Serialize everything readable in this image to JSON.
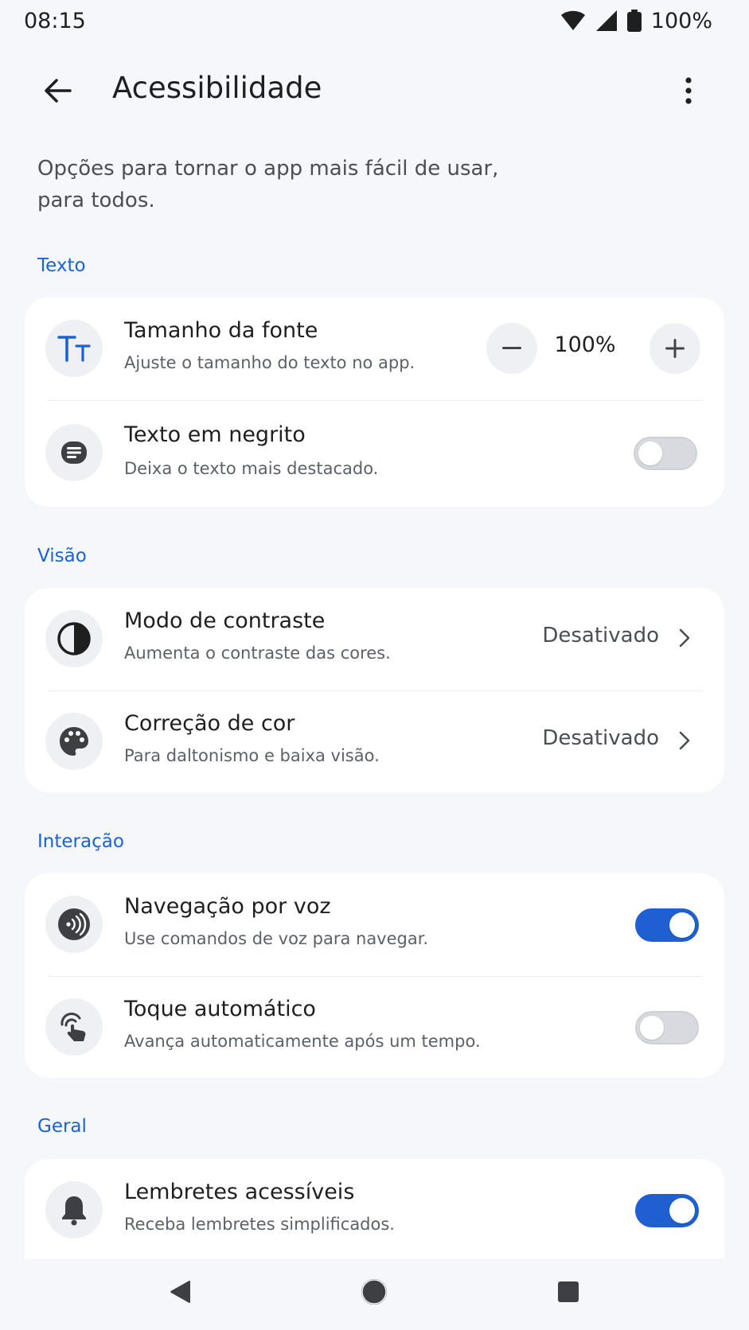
{
  "status_bar": {
    "time": "08:15",
    "battery": "100%"
  },
  "app_bar": {
    "title": "Acessibilidade"
  },
  "intro": "Opções para tornar o app mais fácil de usar, para todos.",
  "sections": {
    "texto": {
      "label": "Texto",
      "font_size": {
        "title": "Tamanho da fonte",
        "subtitle": "Ajuste o tamanho do texto no app.",
        "value": "100%"
      },
      "bold_text": {
        "title": "Texto em negrito",
        "subtitle": "Deixa o texto mais destacado.",
        "enabled": false
      }
    },
    "visao": {
      "label": "Visão",
      "contrast": {
        "title": "Modo de contraste",
        "subtitle": "Aumenta o contraste das cores.",
        "value": "Desativado"
      },
      "color_correction": {
        "title": "Correção de cor",
        "subtitle": "Para daltonismo e baixa visão.",
        "value": "Desativado"
      }
    },
    "interacao": {
      "label": "Interação",
      "voice_nav": {
        "title": "Navegação por voz",
        "subtitle": "Use comandos de voz para navegar.",
        "enabled": true
      },
      "auto_tap": {
        "title": "Toque automático",
        "subtitle": "Avança automaticamente após um tempo.",
        "enabled": false
      }
    },
    "geral": {
      "label": "Geral",
      "reminders": {
        "title": "Lembretes acessíveis",
        "subtitle": "Receba lembretes simplificados.",
        "enabled": true
      }
    }
  },
  "icons": {
    "font_size": "text-size-icon",
    "bold_text": "bold-text-icon",
    "contrast": "contrast-icon",
    "color_correction": "palette-icon",
    "voice_nav": "voice-icon",
    "auto_tap": "touch-icon",
    "reminders": "bell-icon"
  },
  "colors": {
    "accent": "#1f5fd1",
    "section_label": "#1a62d6",
    "background": "#f6f7fb",
    "card": "#ffffff"
  }
}
